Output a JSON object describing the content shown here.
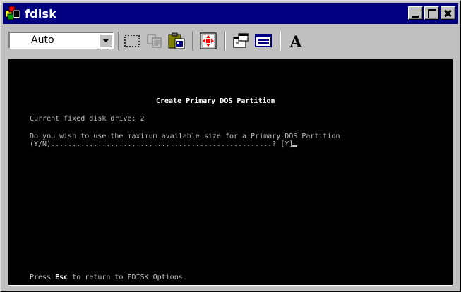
{
  "window": {
    "title": "fdisk",
    "app_icon": "ms-dos-icon"
  },
  "toolbar": {
    "font_size": "Auto",
    "buttons": [
      {
        "name": "mark-button",
        "icon": "mark-icon"
      },
      {
        "name": "copy-button",
        "icon": "copy-icon"
      },
      {
        "name": "paste-button",
        "icon": "paste-icon"
      },
      {
        "name": "full-screen-button",
        "icon": "full-screen-icon"
      },
      {
        "name": "properties-button",
        "icon": "properties-icon"
      },
      {
        "name": "background-button",
        "icon": "background-icon"
      },
      {
        "name": "font-button",
        "icon": "font-icon"
      }
    ],
    "font_button_label": "A"
  },
  "console": {
    "heading": "Create Primary DOS Partition",
    "drive_line": "Current fixed disk drive: 2",
    "question_line1": "Do you wish to use the maximum available size for a Primary DOS Partition",
    "question_line2": "(Y/N)....................................................? [Y]",
    "footer_prefix": "Press ",
    "footer_key": "Esc",
    "footer_suffix": " to return to FDISK Options"
  },
  "colors": {
    "titlebar": "#000080",
    "console_bg": "#000000",
    "console_text": "#c0c0c0",
    "chrome": "#c0c0c0"
  }
}
